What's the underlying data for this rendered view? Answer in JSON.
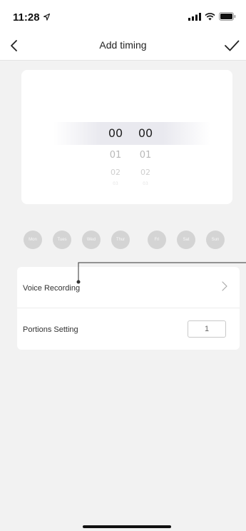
{
  "status_bar": {
    "time": "11:28",
    "icons": [
      "location-arrow-icon",
      "signal-bars-icon",
      "wifi-icon",
      "battery-icon"
    ]
  },
  "nav": {
    "title": "Add timing",
    "back_icon": "chevron-left-icon",
    "confirm_icon": "checkmark-icon"
  },
  "time_picker": {
    "hours": [
      "00",
      "01",
      "02",
      "03"
    ],
    "minutes": [
      "00",
      "01",
      "02",
      "03"
    ],
    "selected_hour": "00",
    "selected_minute": "00"
  },
  "days": [
    {
      "label": "Mon",
      "selected": false
    },
    {
      "label": "Tues",
      "selected": false
    },
    {
      "label": "Wed",
      "selected": false
    },
    {
      "label": "Thur",
      "selected": false
    },
    {
      "label": "Fri",
      "selected": false
    },
    {
      "label": "Sat",
      "selected": false
    },
    {
      "label": "Sun",
      "selected": false
    }
  ],
  "settings": {
    "voice_recording_label": "Voice Recording",
    "portions_label": "Portions Setting",
    "portions_value": "1"
  },
  "colors": {
    "background": "#f2f2f2",
    "card": "#ffffff",
    "day_inactive": "#d4d4d4",
    "text_primary": "#222222",
    "text_faded": "#b9b9b9"
  }
}
